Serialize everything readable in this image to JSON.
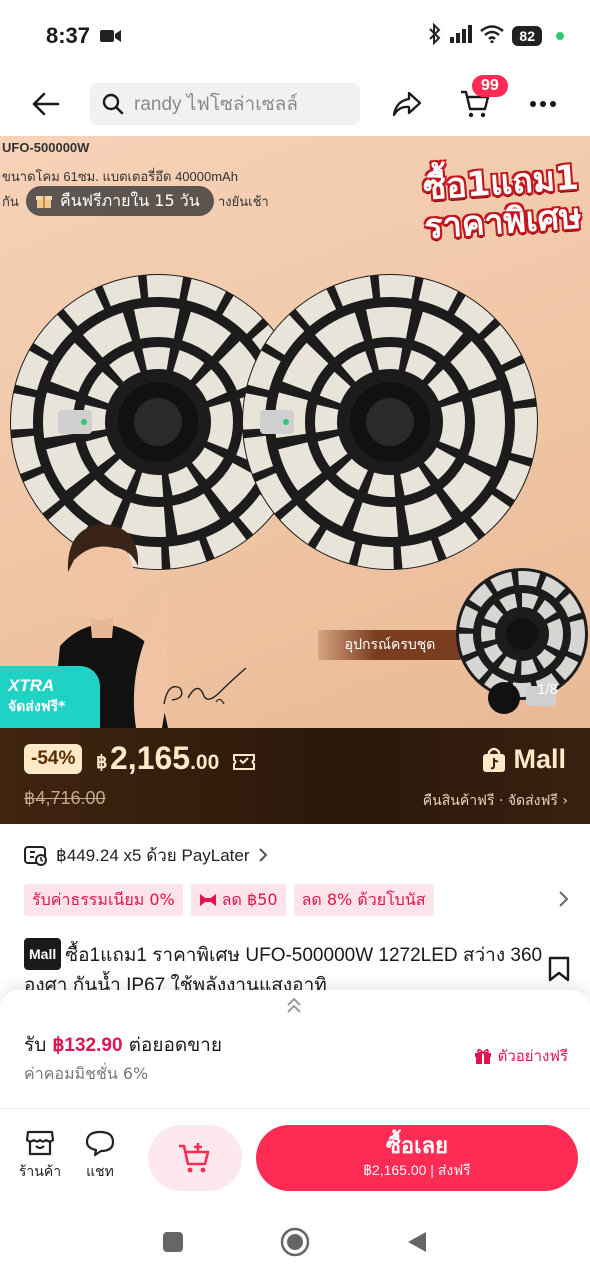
{
  "status": {
    "time": "8:37",
    "battery": "82"
  },
  "header": {
    "search_placeholder": "randy ไฟโซล่าเซลล์",
    "cart_count": "99"
  },
  "hero": {
    "model_line": "UFO-500000W",
    "spec_line": "ขนาดโคม 61ซม. แบตเตอรี่อึด 40000mAh",
    "spec_partial_a": "กัน",
    "spec_partial_b": "างยันเช้า",
    "return_chip": "คืนฟรีภายใน 15 วัน",
    "promo_line1": "ซื้อ1แถม1",
    "promo_line2": "ราคาพิเศษ",
    "accessory_label": "อุปกรณ์ครบชุด",
    "image_counter": "1/8",
    "xtra_title": "XTRA",
    "xtra_sub": "จัดส่งฟรี*"
  },
  "price": {
    "discount": "-54%",
    "currency": "฿",
    "main": "2,165",
    "decimal": ".00",
    "original": "฿4,716.00",
    "mall": "Mall",
    "mall_sub": "คืนสินค้าฟรี · จัดส่งฟรี ›"
  },
  "paylater": {
    "text": "฿449.24 x5 ด้วย PayLater"
  },
  "promos": [
    {
      "label": "รับค่าธรรมเนียม 0%"
    },
    {
      "label": "ลด ฿50"
    },
    {
      "label": "ลด 8% ด้วยโบนัส"
    }
  ],
  "product": {
    "mall_chip": "Mall",
    "title": "ซื้อ1แถม1 ราคาพิเศษ UFO-500000W 1272LED สว่าง 360 องศา กันน้ำ IP67 ใช้พลังงานแสงอาทิ"
  },
  "affiliate": {
    "prefix": "รับ",
    "amount": "฿132.90",
    "suffix": "ต่อยอดขาย",
    "commission": "ค่าคอมมิชชั่น 6%",
    "sample": "ตัวอย่างฟรี"
  },
  "bottom": {
    "shop": "ร้านค้า",
    "chat": "แชท",
    "buy_label": "ซื้อเลย",
    "buy_sub": "฿2,165.00 | ส่งฟรี"
  },
  "colors": {
    "accent": "#fe2c55",
    "promo_text": "#e0144e",
    "price_bar": "#2a170a",
    "xtra": "#1ed2c4"
  }
}
